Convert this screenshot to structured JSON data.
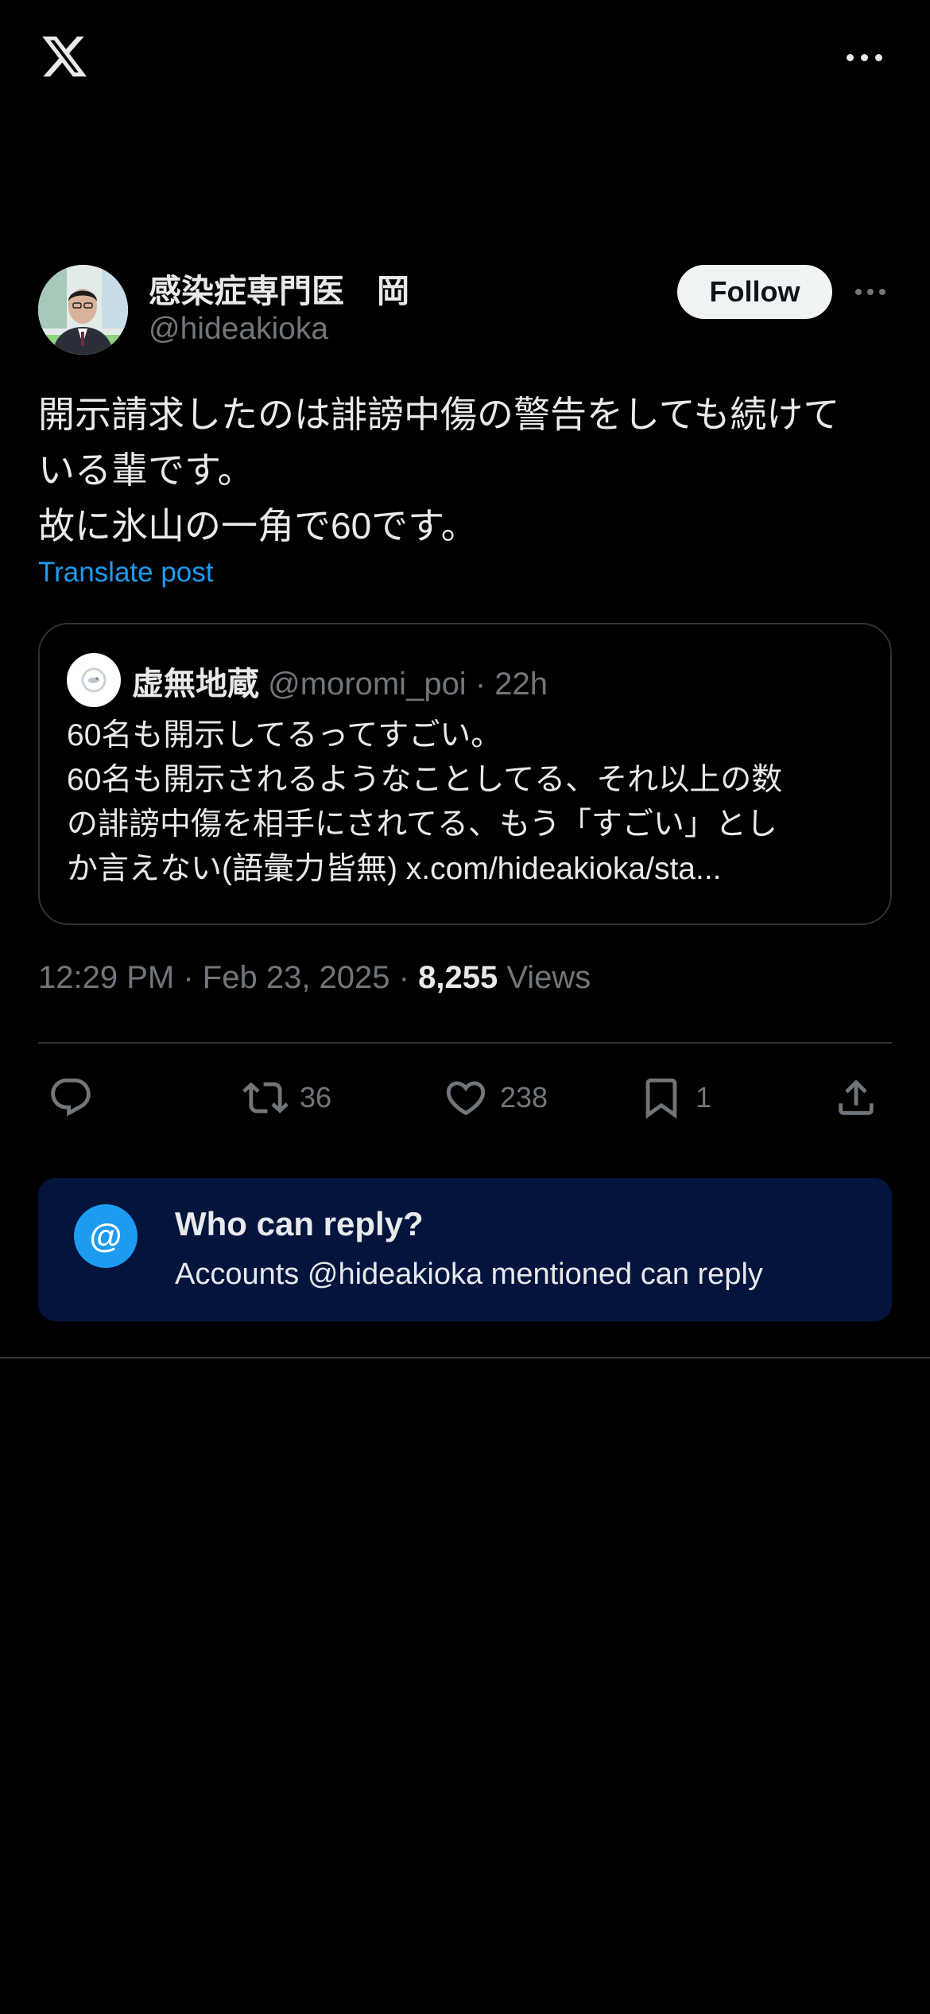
{
  "topbar": {
    "logo": "x-logo",
    "more": "more-horizontal-icon"
  },
  "author": {
    "name": "感染症専門医　岡",
    "handle": "@hideakioka",
    "follow_label": "Follow"
  },
  "post": {
    "lines": [
      "開示請求したのは誹謗中傷の警告をしても続けて",
      "いる輩です。",
      "故に氷山の一角で60です。"
    ],
    "translate_label": "Translate post"
  },
  "quote": {
    "name": "虚無地蔵",
    "handle": "@moromi_poi",
    "time": "22h",
    "lines": [
      "60名も開示してるってすごい。",
      "60名も開示されるようなことしてる、それ以上の数",
      "の誹謗中傷を相手にされてる、もう「すごい」とし",
      "か言えない(語彙力皆無) x.com/hideakioka/sta..."
    ]
  },
  "meta": {
    "time": "12:29 PM",
    "date": "Feb 23, 2025",
    "views_count": "8,255",
    "views_label": "Views"
  },
  "actions": {
    "reply_icon": "reply-icon",
    "repost_count": "36",
    "like_count": "238",
    "bookmark_count": "1",
    "share_icon": "share-icon"
  },
  "reply_settings": {
    "title": "Who can reply?",
    "subtitle": "Accounts @hideakioka mentioned can reply",
    "icon_symbol": "@"
  },
  "colors": {
    "background": "#000000",
    "text": "#e7e9ea",
    "muted": "#71767b",
    "link": "#1d9bf0",
    "reply_box": "#04143d",
    "divider": "#2f3336"
  }
}
